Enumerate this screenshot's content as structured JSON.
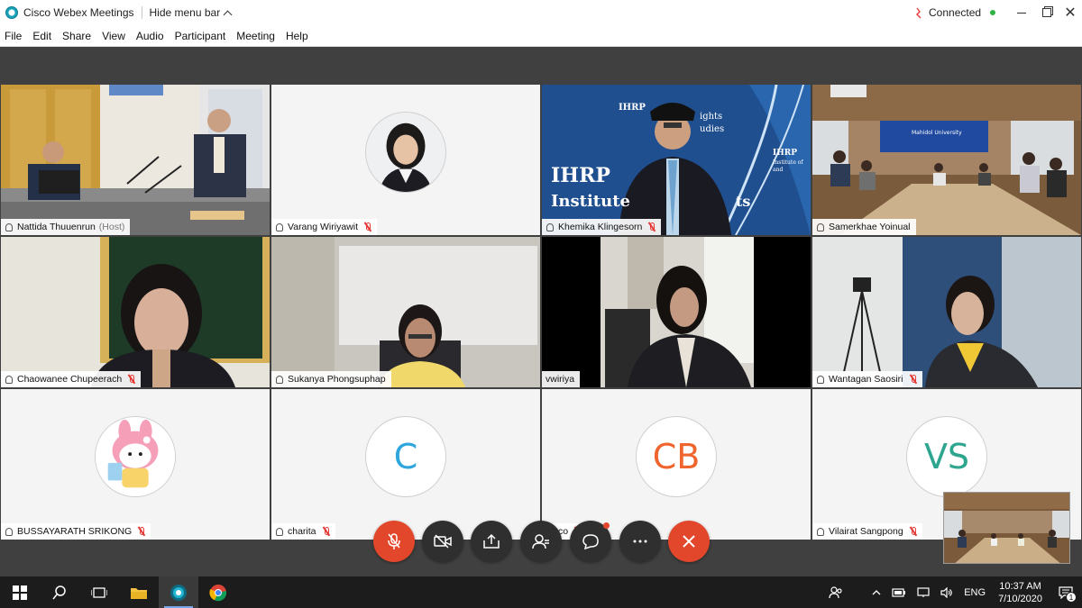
{
  "window": {
    "title": "Cisco Webex Meetings",
    "hide_menu_label": "Hide menu bar",
    "status": "Connected"
  },
  "menu": [
    "File",
    "Edit",
    "Share",
    "View",
    "Audio",
    "Participant",
    "Meeting",
    "Help"
  ],
  "participants": [
    {
      "name": "Nattida Thuuenrun",
      "role": "(Host)",
      "muted": false,
      "view": "video",
      "active": true
    },
    {
      "name": "Varang Wiriyawit",
      "muted": true,
      "view": "photo-avatar"
    },
    {
      "name": "Khemika Klingesorn",
      "muted": true,
      "view": "video"
    },
    {
      "name": "Samerkhae Yoinual",
      "muted": false,
      "view": "video"
    },
    {
      "name": "Chaowanee Chupeerach",
      "muted": true,
      "view": "video"
    },
    {
      "name": "Sukanya Phongsuphap",
      "muted": false,
      "view": "video"
    },
    {
      "name": "vwiriya",
      "muted": false,
      "view": "video"
    },
    {
      "name": "Wantagan Saosiri",
      "muted": true,
      "view": "video"
    },
    {
      "name": "BUSSAYARATH SRIKONG",
      "muted": true,
      "view": "image-avatar"
    },
    {
      "name": "charita",
      "muted": true,
      "view": "initials",
      "initials": "C",
      "initials_color": "#2ea6dd"
    },
    {
      "name": "co",
      "muted": true,
      "view": "initials",
      "initials": "CB",
      "initials_color": "#f0642d"
    },
    {
      "name": "Vilairat Sangpong",
      "muted": true,
      "view": "initials",
      "initials": "VS",
      "initials_color": "#2ea58f"
    }
  ],
  "khemika_backdrop": {
    "org_short": "IHRP",
    "org_full": "Institute",
    "frag_1": "IHRP",
    "frag_2": "Institute",
    "frag_3": "ights",
    "frag_4": "udies",
    "frag_5": "ts",
    "frag_6": "IHRP",
    "frag_7": "Institute of",
    "frag_8": "and"
  },
  "conference_banner": "Mahidol University",
  "controls": [
    {
      "name": "mute-button",
      "icon": "mic-off-icon"
    },
    {
      "name": "video-button",
      "icon": "video-off-icon"
    },
    {
      "name": "share-button",
      "icon": "share-icon"
    },
    {
      "name": "participants-button",
      "icon": "participants-icon"
    },
    {
      "name": "chat-button",
      "icon": "chat-icon"
    },
    {
      "name": "more-button",
      "icon": "more-icon"
    },
    {
      "name": "leave-button",
      "icon": "close-icon"
    }
  ],
  "taskbar": {
    "language": "ENG",
    "time": "10:37 AM",
    "date": "7/10/2020",
    "notification_count": "1"
  },
  "colors": {
    "stage": "#404040",
    "active_border": "#35b7e6",
    "red": "#e2462b"
  }
}
